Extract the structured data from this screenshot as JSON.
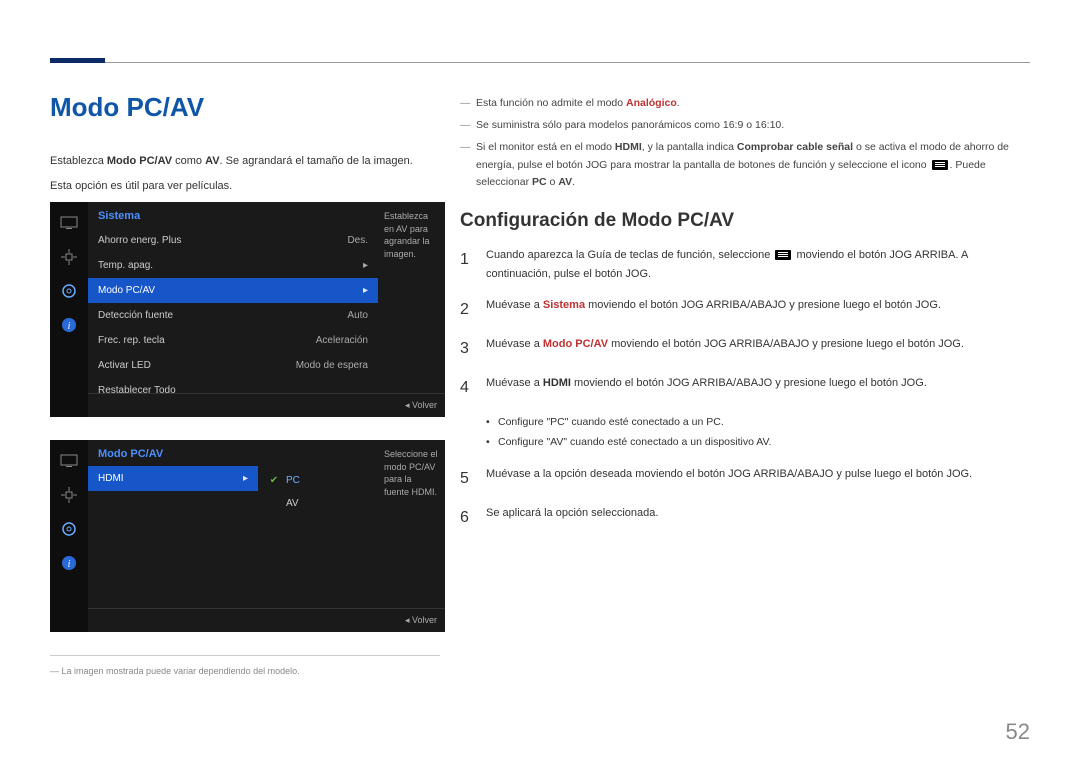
{
  "page": {
    "title": "Modo PC/AV",
    "intro_a": "Establezca ",
    "intro_b": "Modo PC/AV",
    "intro_c": " como ",
    "intro_d": "AV",
    "intro_e": ". Se agrandará el tamaño de la imagen.",
    "intro2": "Esta opción es útil para ver películas.",
    "pagenum": "52"
  },
  "osd1": {
    "header": "Sistema",
    "desc": "Establezca en AV para agrandar la imagen.",
    "rows": [
      {
        "label": "Ahorro energ. Plus",
        "val": "Des."
      },
      {
        "label": "Temp. apag.",
        "val": "▸"
      },
      {
        "label": "Modo PC/AV",
        "val": "▸"
      },
      {
        "label": "Detección fuente",
        "val": "Auto"
      },
      {
        "label": "Frec. rep. tecla",
        "val": "Aceleración"
      },
      {
        "label": "Activar LED",
        "val": "Modo de espera"
      },
      {
        "label": "Restablecer Todo",
        "val": ""
      }
    ],
    "footer": "◂    Volver"
  },
  "osd2": {
    "header": "Modo PC/AV",
    "desc": "Seleccione el modo PC/AV para la fuente HDMI.",
    "row_label": "HDMI",
    "opts": [
      "PC",
      "AV"
    ],
    "footer": "◂    Volver"
  },
  "imgnote": "La imagen mostrada puede variar dependiendo del modelo.",
  "notes": {
    "n1a": "Esta función no admite el modo ",
    "n1b": "Analógico",
    "n1c": ".",
    "n2": "Se suministra sólo para modelos panorámicos como 16:9 o 16:10.",
    "n3a": "Si el monitor está en el modo ",
    "n3b": "HDMI",
    "n3c": ", y la pantalla indica ",
    "n3d": "Comprobar cable señal",
    "n3e": " o se activa el modo de ahorro de energía, pulse el botón JOG para mostrar la pantalla de botones de función y seleccione el icono ",
    "n3f": ". Puede seleccionar ",
    "n3g": "PC",
    "n3h": " o ",
    "n3i": "AV",
    "n3j": "."
  },
  "config": {
    "title": "Configuración de Modo PC/AV",
    "steps": [
      {
        "n": "1",
        "a": "Cuando aparezca la Guía de teclas de función, seleccione ",
        "b": " moviendo el botón JOG ARRIBA. A continuación, pulse el botón JOG."
      },
      {
        "n": "2",
        "a": "Muévase a ",
        "kw": "Sistema",
        "kwcolor": "red",
        "b": " moviendo el botón JOG ARRIBA/ABAJO y presione luego el botón JOG."
      },
      {
        "n": "3",
        "a": "Muévase a ",
        "kw": "Modo PC/AV",
        "kwcolor": "red",
        "b": " moviendo el botón JOG ARRIBA/ABAJO y presione luego el botón JOG."
      },
      {
        "n": "4",
        "a": "Muévase a ",
        "kw": "HDMI",
        "kwcolor": "bold",
        "b": " moviendo el botón JOG ARRIBA/ABAJO y presione luego el botón JOG."
      },
      {
        "n": "5",
        "a": "Muévase a la opción deseada moviendo el botón JOG ARRIBA/ABAJO y pulse luego el botón JOG."
      },
      {
        "n": "6",
        "a": "Se aplicará la opción seleccionada."
      }
    ],
    "bullets": [
      "Configure \"PC\" cuando esté conectado a un PC.",
      "Configure \"AV\" cuando esté conectado a un dispositivo AV."
    ]
  }
}
